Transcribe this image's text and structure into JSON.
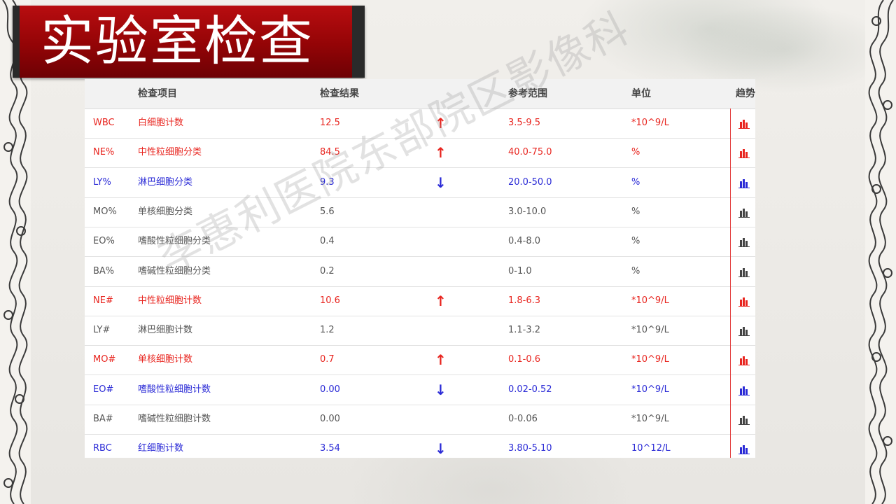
{
  "title": "实验室检查",
  "watermark": "李惠利医院东部院区影像科",
  "columns": {
    "code": "",
    "item": "检查项目",
    "result": "检查结果",
    "flag": "",
    "range": "参考范围",
    "unit": "单位",
    "trend": "趋势"
  },
  "colors": {
    "high": "#e8251f",
    "low": "#2a2ad6",
    "normal": "#555555",
    "banner": "#a0080b"
  },
  "rows": [
    {
      "code": "WBC",
      "name": "白细胞计数",
      "result": "12.5",
      "arrow": "↑",
      "range": "3.5-9.5",
      "unit": "*10^9/L",
      "status": "high"
    },
    {
      "code": "NE%",
      "name": "中性粒细胞分类",
      "result": "84.5",
      "arrow": "↑",
      "range": "40.0-75.0",
      "unit": "%",
      "status": "high"
    },
    {
      "code": "LY%",
      "name": "淋巴细胞分类",
      "result": "9.3",
      "arrow": "↓",
      "range": "20.0-50.0",
      "unit": "%",
      "status": "low"
    },
    {
      "code": "MO%",
      "name": "单核细胞分类",
      "result": "5.6",
      "arrow": "",
      "range": "3.0-10.0",
      "unit": "%",
      "status": "normal"
    },
    {
      "code": "EO%",
      "name": "嗜酸性粒细胞分类",
      "result": "0.4",
      "arrow": "",
      "range": "0.4-8.0",
      "unit": "%",
      "status": "normal"
    },
    {
      "code": "BA%",
      "name": "嗜碱性粒细胞分类",
      "result": "0.2",
      "arrow": "",
      "range": "0-1.0",
      "unit": "%",
      "status": "normal"
    },
    {
      "code": "NE#",
      "name": "中性粒细胞计数",
      "result": "10.6",
      "arrow": "↑",
      "range": "1.8-6.3",
      "unit": "*10^9/L",
      "status": "high"
    },
    {
      "code": "LY#",
      "name": "淋巴细胞计数",
      "result": "1.2",
      "arrow": "",
      "range": "1.1-3.2",
      "unit": "*10^9/L",
      "status": "normal"
    },
    {
      "code": "MO#",
      "name": "单核细胞计数",
      "result": "0.7",
      "arrow": "↑",
      "range": "0.1-0.6",
      "unit": "*10^9/L",
      "status": "high"
    },
    {
      "code": "EO#",
      "name": "嗜酸性粒细胞计数",
      "result": "0.00",
      "arrow": "↓",
      "range": "0.02-0.52",
      "unit": "*10^9/L",
      "status": "low"
    },
    {
      "code": "BA#",
      "name": "嗜碱性粒细胞计数",
      "result": "0.00",
      "arrow": "",
      "range": "0-0.06",
      "unit": "*10^9/L",
      "status": "normal"
    },
    {
      "code": "RBC",
      "name": "红细胞计数",
      "result": "3.54",
      "arrow": "↓",
      "range": "3.80-5.10",
      "unit": "10^12/L",
      "status": "low"
    }
  ]
}
